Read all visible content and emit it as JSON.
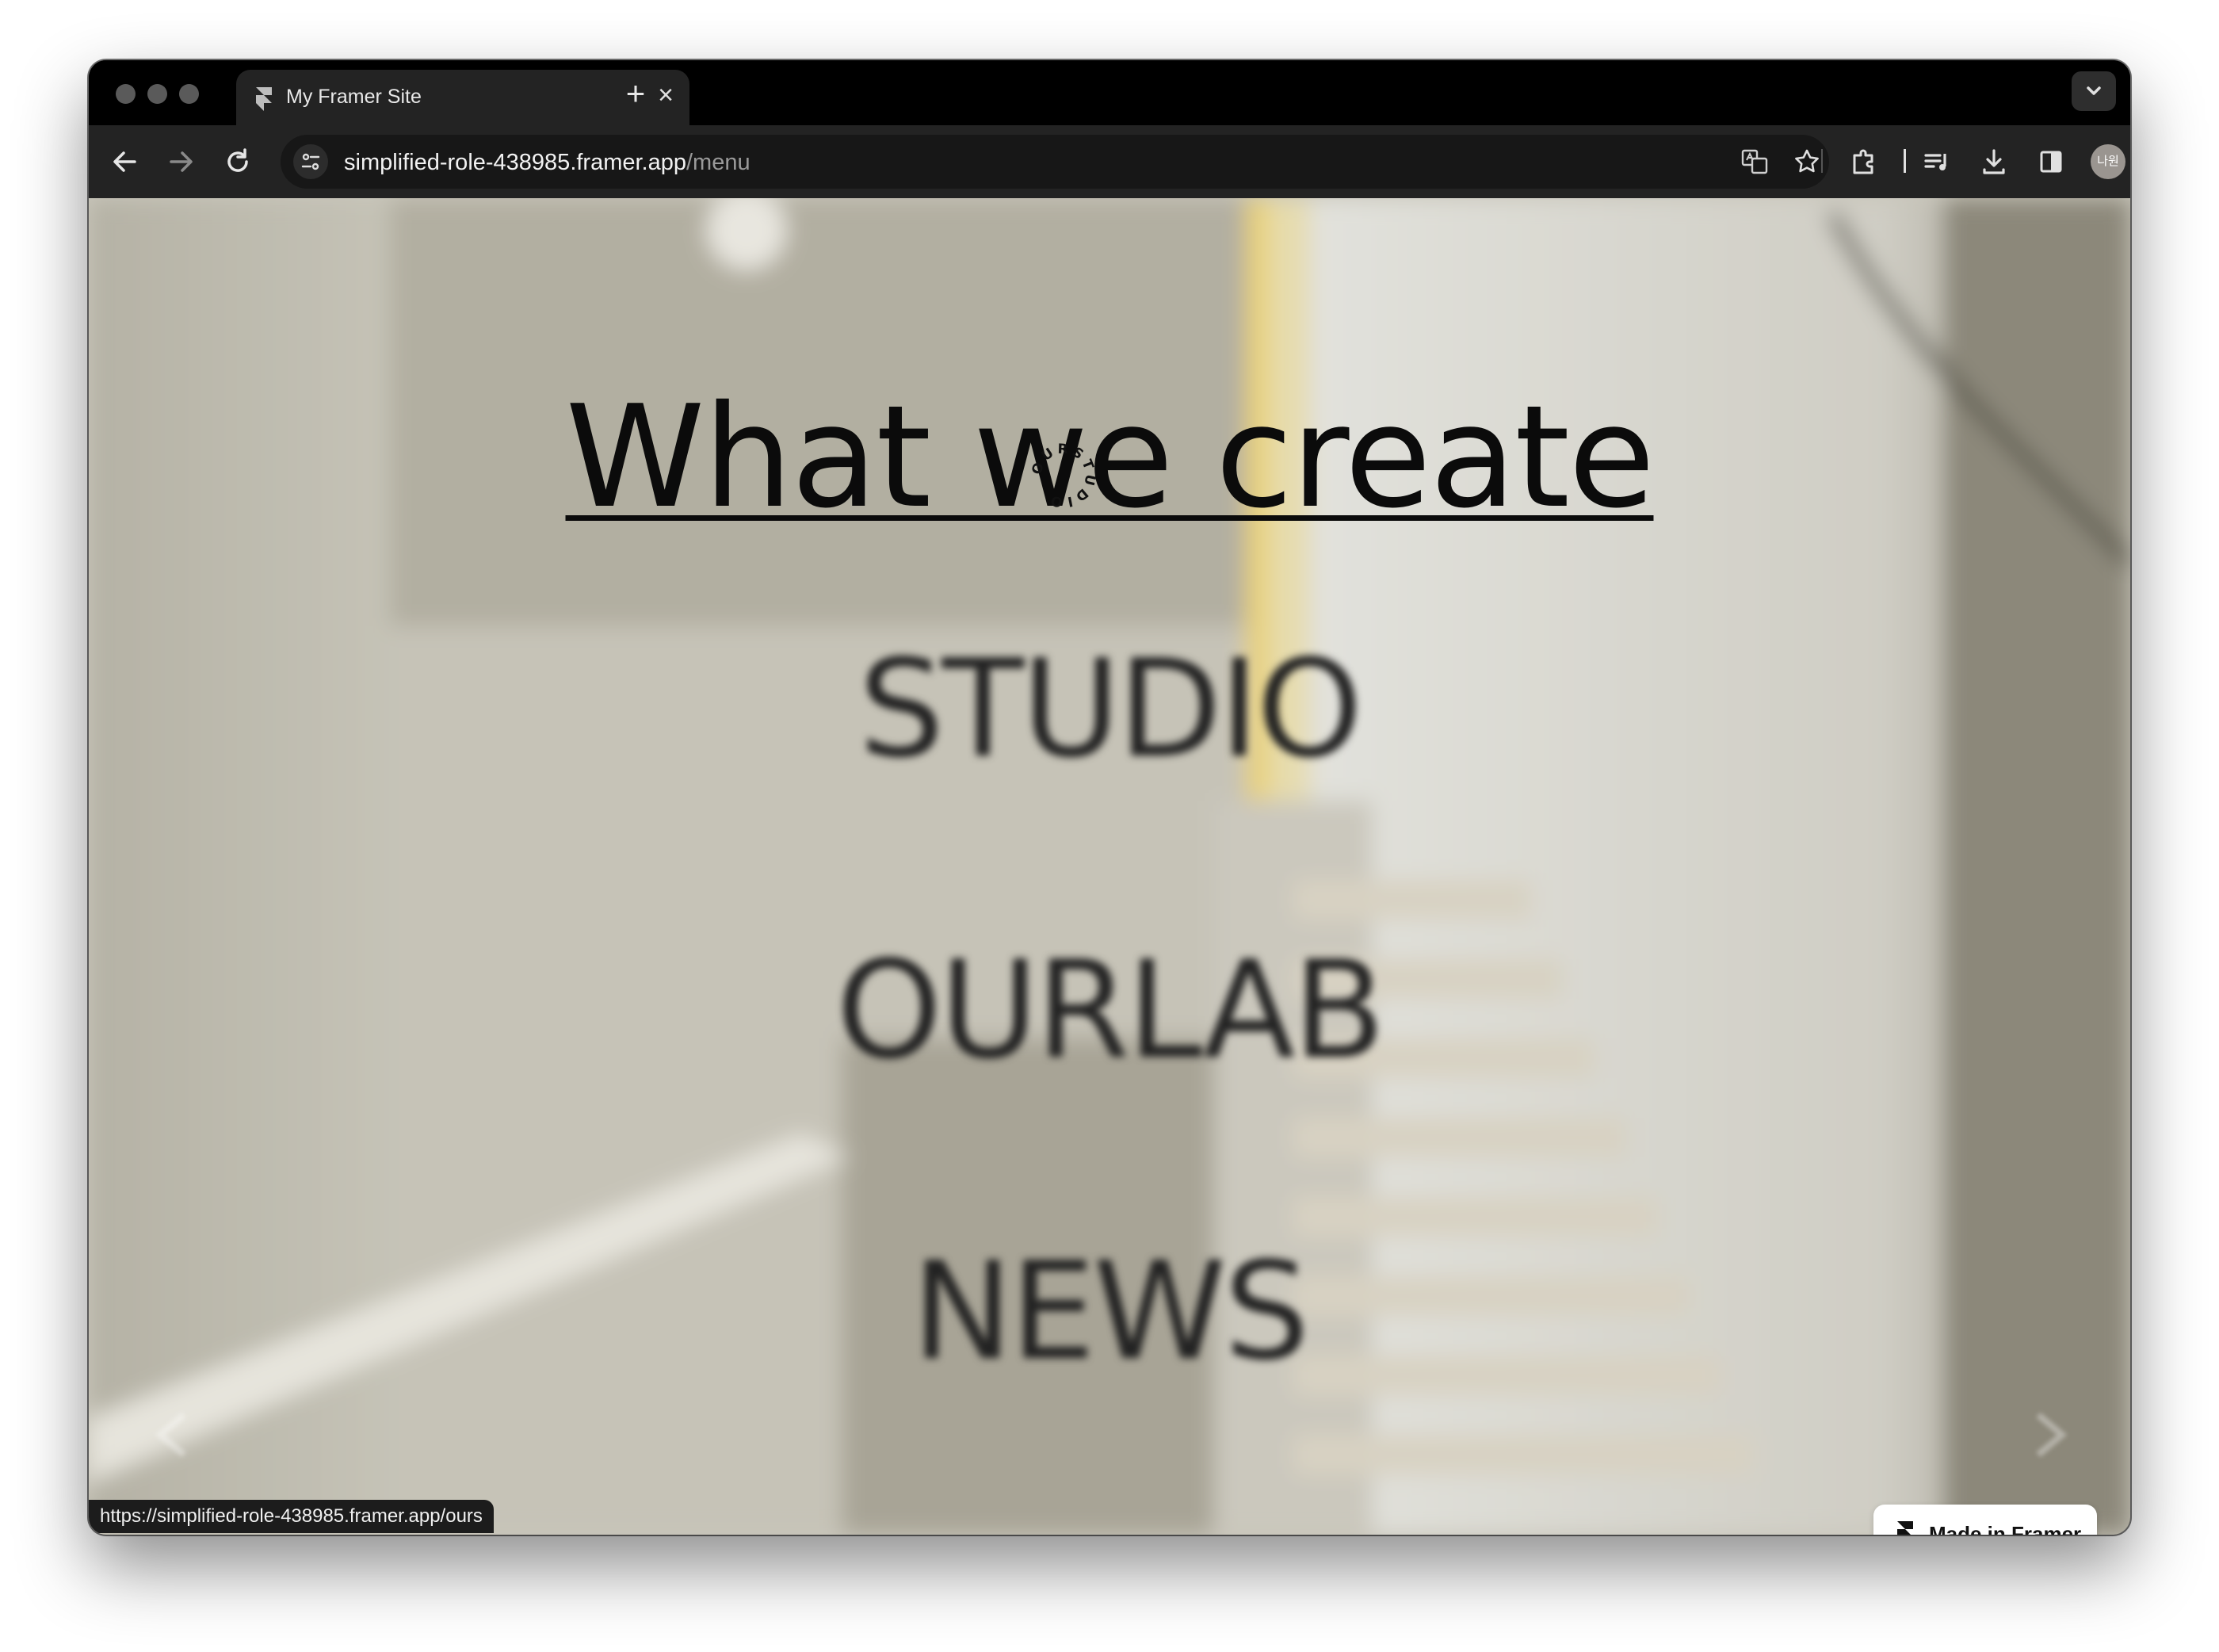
{
  "browser": {
    "tab": {
      "title": "My Framer Site",
      "close_glyph": "×",
      "favicon": "framer-icon"
    },
    "new_tab_glyph": "+",
    "address": {
      "host": "simplified-role-438985.framer.app",
      "path": "/menu"
    },
    "profile_initials": "나원",
    "status_url": "https://simplified-role-438985.framer.app/ours"
  },
  "page": {
    "headline": "What we create",
    "badge_text": "OURSTUDIO",
    "menu": [
      "STUDIO",
      "OURLAB",
      "NEWS"
    ],
    "framer_badge": "Made in Framer"
  },
  "colors": {
    "tab_bar": "#000000",
    "toolbar": "#232323",
    "page_background": "#c9c6bb",
    "accent_yellow": "#e9d27a"
  }
}
